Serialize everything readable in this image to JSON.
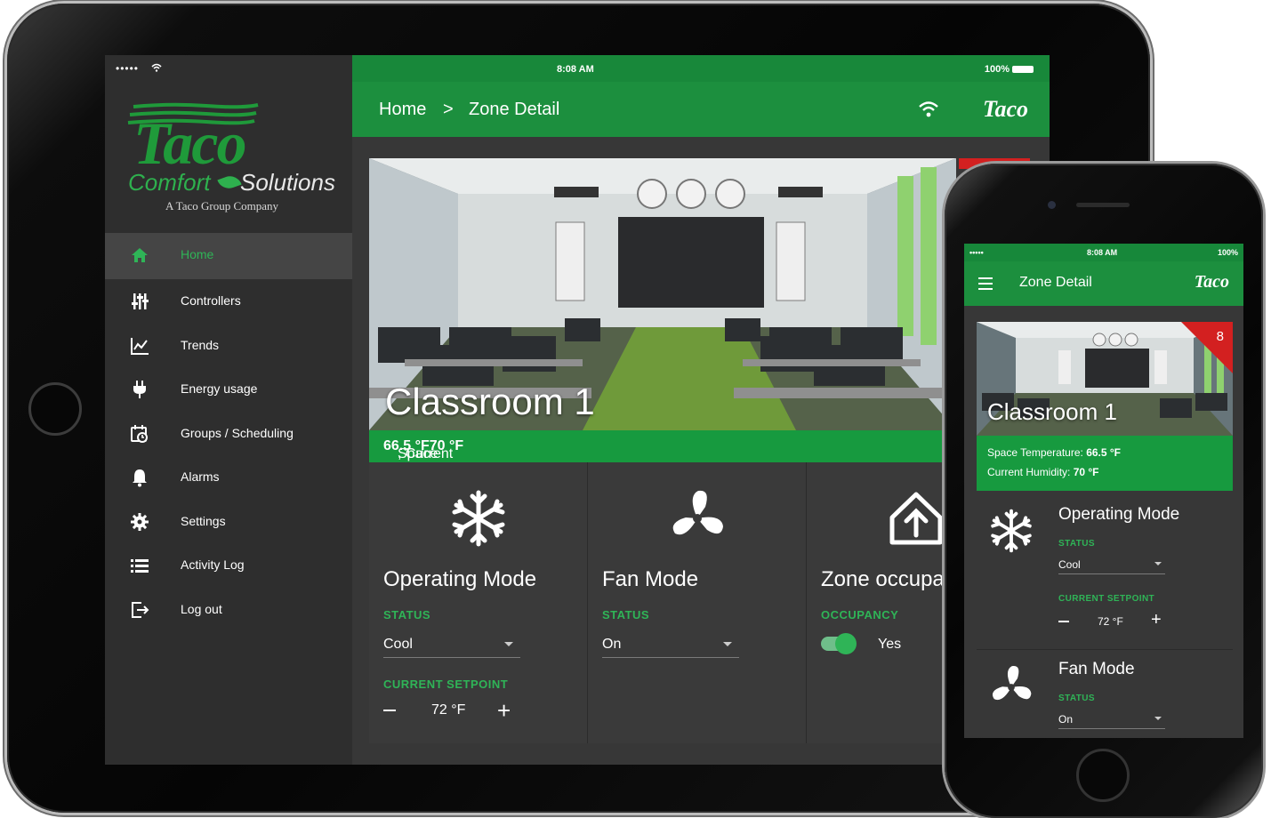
{
  "tablet": {
    "status": {
      "signal": "••••• ",
      "time": "8:08 AM",
      "battery": "100%"
    },
    "logo": {
      "brand": "Taco",
      "comfort": "Comfort",
      "solutions": "Solutions",
      "tagline": "A Taco Group Company"
    },
    "nav": [
      {
        "label": "Home",
        "icon": "home-icon",
        "active": true
      },
      {
        "label": "Controllers",
        "icon": "sliders-icon"
      },
      {
        "label": "Trends",
        "icon": "line-chart-icon"
      },
      {
        "label": "Energy usage",
        "icon": "plug-icon"
      },
      {
        "label": "Groups / Scheduling",
        "icon": "calendar-clock-icon"
      },
      {
        "label": "Alarms",
        "icon": "bell-icon"
      },
      {
        "label": "Settings",
        "icon": "gear-icon"
      },
      {
        "label": "Activity Log",
        "icon": "list-icon"
      },
      {
        "label": "Log out",
        "icon": "logout-icon"
      }
    ],
    "breadcrumb": {
      "home": "Home",
      "separator": ">",
      "current": "Zone Detail"
    },
    "header_logo": "Taco",
    "room": {
      "title": "Classroom 1"
    },
    "banner": {
      "temp_label": "Space Temperature: ",
      "temp_value": "66.5 °F",
      "hum_label": ", Current Humidity: ",
      "hum_value": "70 °F"
    },
    "cards": {
      "operating": {
        "title": "Operating Mode",
        "status_label": "STATUS",
        "status_value": "Cool",
        "setpoint_label": "CURRENT SETPOINT",
        "setpoint_value": "72 °F",
        "plus": "+"
      },
      "fan": {
        "title": "Fan Mode",
        "status_label": "STATUS",
        "status_value": "On"
      },
      "zone": {
        "title": "Zone occupa",
        "occupancy_label": "OCCUPANCY",
        "occupancy_value": "Yes",
        "occupied": true
      }
    }
  },
  "phone": {
    "status": {
      "signal": "••••• ",
      "time": "8:08 AM",
      "battery": "100%"
    },
    "title": "Zone Detail",
    "header_logo": "Taco",
    "room": {
      "title": "Classroom 1",
      "badge": "8"
    },
    "banner": {
      "temp_label": "Space Temperature: ",
      "temp_value": "66.5 °F",
      "hum_label": "Current Humidity: ",
      "hum_value": "70 °F"
    },
    "operating": {
      "title": "Operating Mode",
      "status_label": "STATUS",
      "status_value": "Cool",
      "setpoint_label": "CURRENT SETPOINT",
      "setpoint_value": "72 °F",
      "plus": "+"
    },
    "fan": {
      "title": "Fan Mode",
      "status_label": "STATUS",
      "status_value": "On"
    }
  },
  "colors": {
    "accent_green": "#1c8f3e",
    "label_green": "#2fb457",
    "panel": "#373737",
    "sidebar": "#2e2e2e",
    "alert_red": "#d32020"
  }
}
